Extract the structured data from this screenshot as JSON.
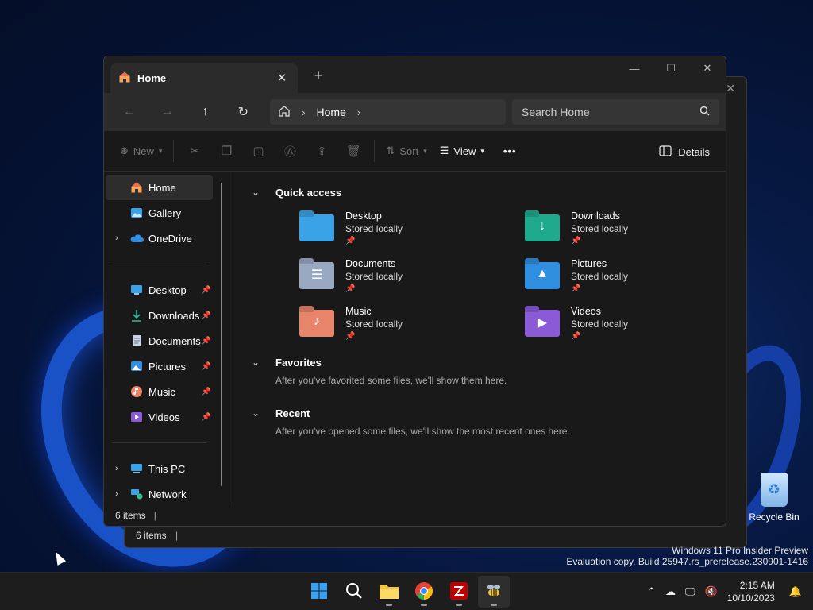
{
  "window": {
    "tab_title": "Home",
    "new_tab": "+",
    "controls": {
      "minimize": "—",
      "maximize": "☐",
      "close": "✕"
    }
  },
  "nav": {
    "breadcrumb": "Home",
    "search_placeholder": "Search Home"
  },
  "toolbar": {
    "new_label": "New",
    "sort_label": "Sort",
    "view_label": "View",
    "more_label": "•••",
    "details_label": "Details"
  },
  "sidebar": {
    "top": [
      {
        "label": "Home",
        "icon": "home-icon",
        "selected": true
      },
      {
        "label": "Gallery",
        "icon": "gallery-icon"
      },
      {
        "label": "OneDrive",
        "icon": "onedrive-icon",
        "expandable": true
      }
    ],
    "pinned": [
      {
        "label": "Desktop",
        "icon": "desktop-icon"
      },
      {
        "label": "Downloads",
        "icon": "downloads-icon"
      },
      {
        "label": "Documents",
        "icon": "documents-icon"
      },
      {
        "label": "Pictures",
        "icon": "pictures-icon"
      },
      {
        "label": "Music",
        "icon": "music-icon"
      },
      {
        "label": "Videos",
        "icon": "videos-icon"
      }
    ],
    "bottom": [
      {
        "label": "This PC",
        "icon": "this-pc-icon"
      },
      {
        "label": "Network",
        "icon": "network-icon"
      }
    ]
  },
  "main": {
    "quick_access_title": "Quick access",
    "quick_access": [
      {
        "name": "Desktop",
        "sub": "Stored locally",
        "color": "#3aa3e8"
      },
      {
        "name": "Downloads",
        "sub": "Stored locally",
        "color": "#1faa8e"
      },
      {
        "name": "Documents",
        "sub": "Stored locally",
        "color": "#9aa9c2"
      },
      {
        "name": "Pictures",
        "sub": "Stored locally",
        "color": "#2f8ee0"
      },
      {
        "name": "Music",
        "sub": "Stored locally",
        "color": "#e8846a"
      },
      {
        "name": "Videos",
        "sub": "Stored locally",
        "color": "#8b5ad6"
      }
    ],
    "favorites_title": "Favorites",
    "favorites_hint": "After you've favorited some files, we'll show them here.",
    "recent_title": "Recent",
    "recent_hint": "After you've opened some files, we'll show the most recent ones here."
  },
  "status": {
    "items": "6 items",
    "bg_items": "6 items"
  },
  "desktop": {
    "recycle_bin": "Recycle Bin",
    "watermark_line1": "Windows 11 Pro Insider Preview",
    "watermark_line2": "Evaluation copy. Build 25947.rs_prerelease.230901-1416"
  },
  "taskbar": {
    "time": "2:15 AM",
    "date": "10/10/2023"
  }
}
